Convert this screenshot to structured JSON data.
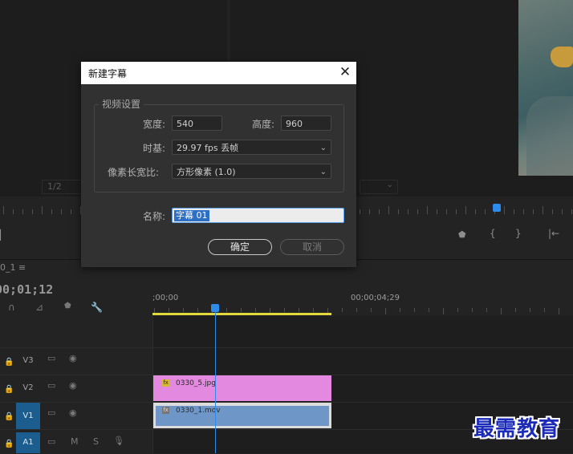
{
  "dialog": {
    "title": "新建字幕",
    "close_glyph": "✕",
    "group_title": "视频设置",
    "width_label": "宽度:",
    "width_value": "540",
    "height_label": "高度:",
    "height_value": "960",
    "timebase_label": "时基:",
    "timebase_value": "29.97  fps 丢帧",
    "pixel_aspect_label": "像素长宽比:",
    "pixel_aspect_value": "方形像素 (1.0)",
    "name_label": "名称:",
    "name_value": "字幕 01",
    "ok_label": "确定",
    "cancel_label": "取消"
  },
  "source_monitor": {
    "scale": "1/2"
  },
  "timeline": {
    "sequence_tab": "0_1  ≡",
    "timecode": "00;01;12",
    "ruler_start": ";00;00",
    "ruler_mark": "00;00;04;29",
    "tracks": [
      {
        "name": "V3",
        "active": false
      },
      {
        "name": "V2",
        "active": false
      },
      {
        "name": "V1",
        "active": true
      },
      {
        "name": "A1",
        "active": true
      }
    ],
    "audio_m": "M",
    "audio_s": "S",
    "clips": {
      "v2": "0330_5.jpg",
      "v1": "0330_1.mov"
    },
    "fx_label": "fx"
  },
  "watermark": "最需教育",
  "colors": {
    "accent": "#2d8ceb",
    "work_area": "#e2d73d",
    "clip_graphic": "#e389e0",
    "clip_video": "#6e97c8"
  },
  "icons": [
    "close-icon",
    "dropdown-chevron-icon",
    "lock-icon",
    "eye-icon",
    "toggle-output-icon",
    "marker-icon",
    "wrench-icon",
    "snap-icon",
    "microphone-icon"
  ]
}
